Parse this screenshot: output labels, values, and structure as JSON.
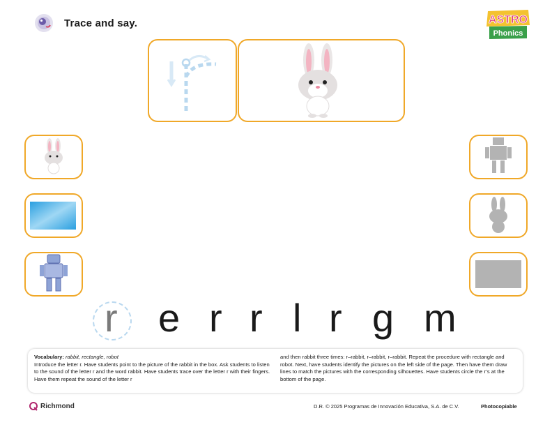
{
  "header": {
    "title": "Trace and say.",
    "logo_top": "ASTRO",
    "logo_bottom": "Phonics"
  },
  "letters": [
    "r",
    "e",
    "r",
    "r",
    "l",
    "r",
    "g",
    "m"
  ],
  "notes": {
    "vocab_label": "Vocabulary:",
    "vocab_words": "rabbit, rectangle, robot",
    "left_text": "Introduce the letter r. Have students point to the picture of the rabbit in the box. Ask students to listen to the sound of the letter r and the word rabbit. Have students trace over the letter r with their fingers. Have them repeat the sound of the letter r",
    "right_text": "and then rabbit three times: r–rabbit, r–rabbit, r–rabbit. Repeat the procedure with rectangle and robot. Next, have students identify the pictures on the left side of the page. Then have them draw lines to match the pictures with the corresponding silhouettes. Have students circle the r’s at the bottom of the page."
  },
  "footer": {
    "brand": "Richmond",
    "copyright": "D.R. © 2025 Programas de Innovación Educativa, S.A. de C.V.",
    "photocopiable": "Photocopiable"
  },
  "colors": {
    "box_border": "#f0a828",
    "trace_blue": "#b9d8ef",
    "silhouette": "#b3b3b3",
    "rectangle_blue": "#5ab6ea"
  }
}
